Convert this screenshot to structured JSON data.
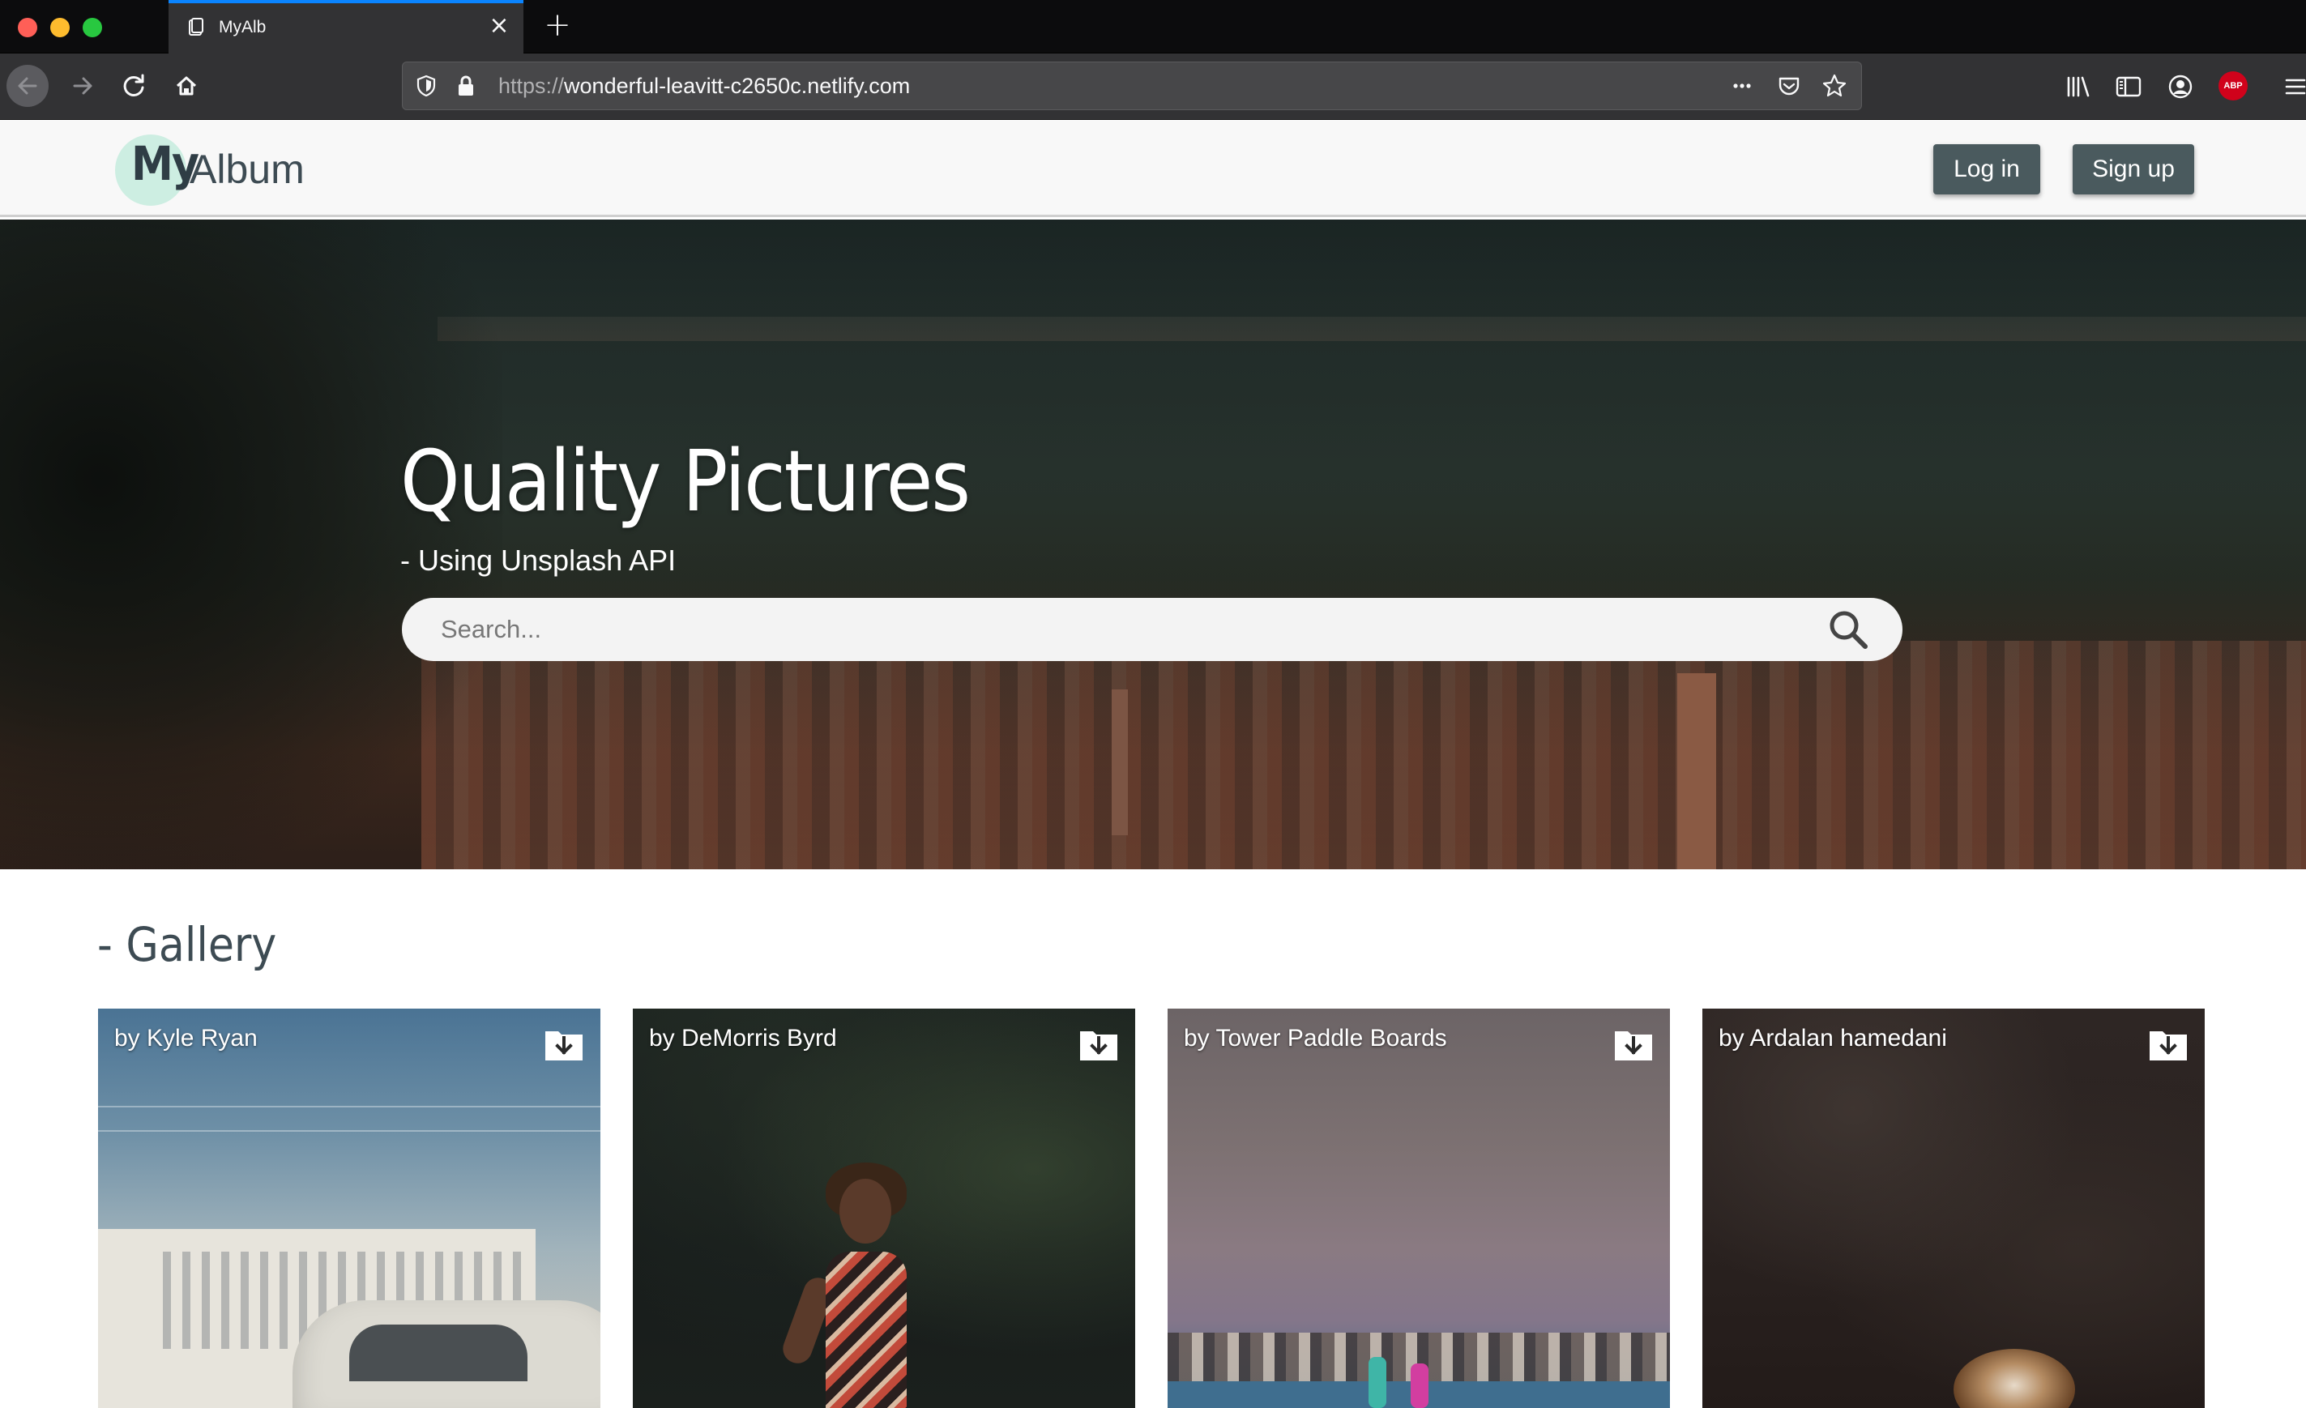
{
  "browser": {
    "tab_title": "MyAlb",
    "url_scheme": "https://",
    "url_host": "wonderful-leavitt-c2650c.netlify.com",
    "abp_label": "ABP"
  },
  "header": {
    "logo_my": "My",
    "logo_album": "Album",
    "login_label": "Log in",
    "signup_label": "Sign up"
  },
  "hero": {
    "title": "Quality Pictures",
    "subtitle": "- Using Unsplash API",
    "search_placeholder": "Search..."
  },
  "gallery": {
    "title": "- Gallery",
    "cards": [
      {
        "author": "by Kyle Ryan"
      },
      {
        "author": "by DeMorris Byrd"
      },
      {
        "author": "by Tower Paddle Boards"
      },
      {
        "author": "by Ardalan hamedani"
      }
    ]
  },
  "colors": {
    "button_bg": "#4a5a5e",
    "logo_circle": "#cdeee2",
    "header_bg": "#f8f8f8",
    "text_dark": "#3d4b53"
  }
}
